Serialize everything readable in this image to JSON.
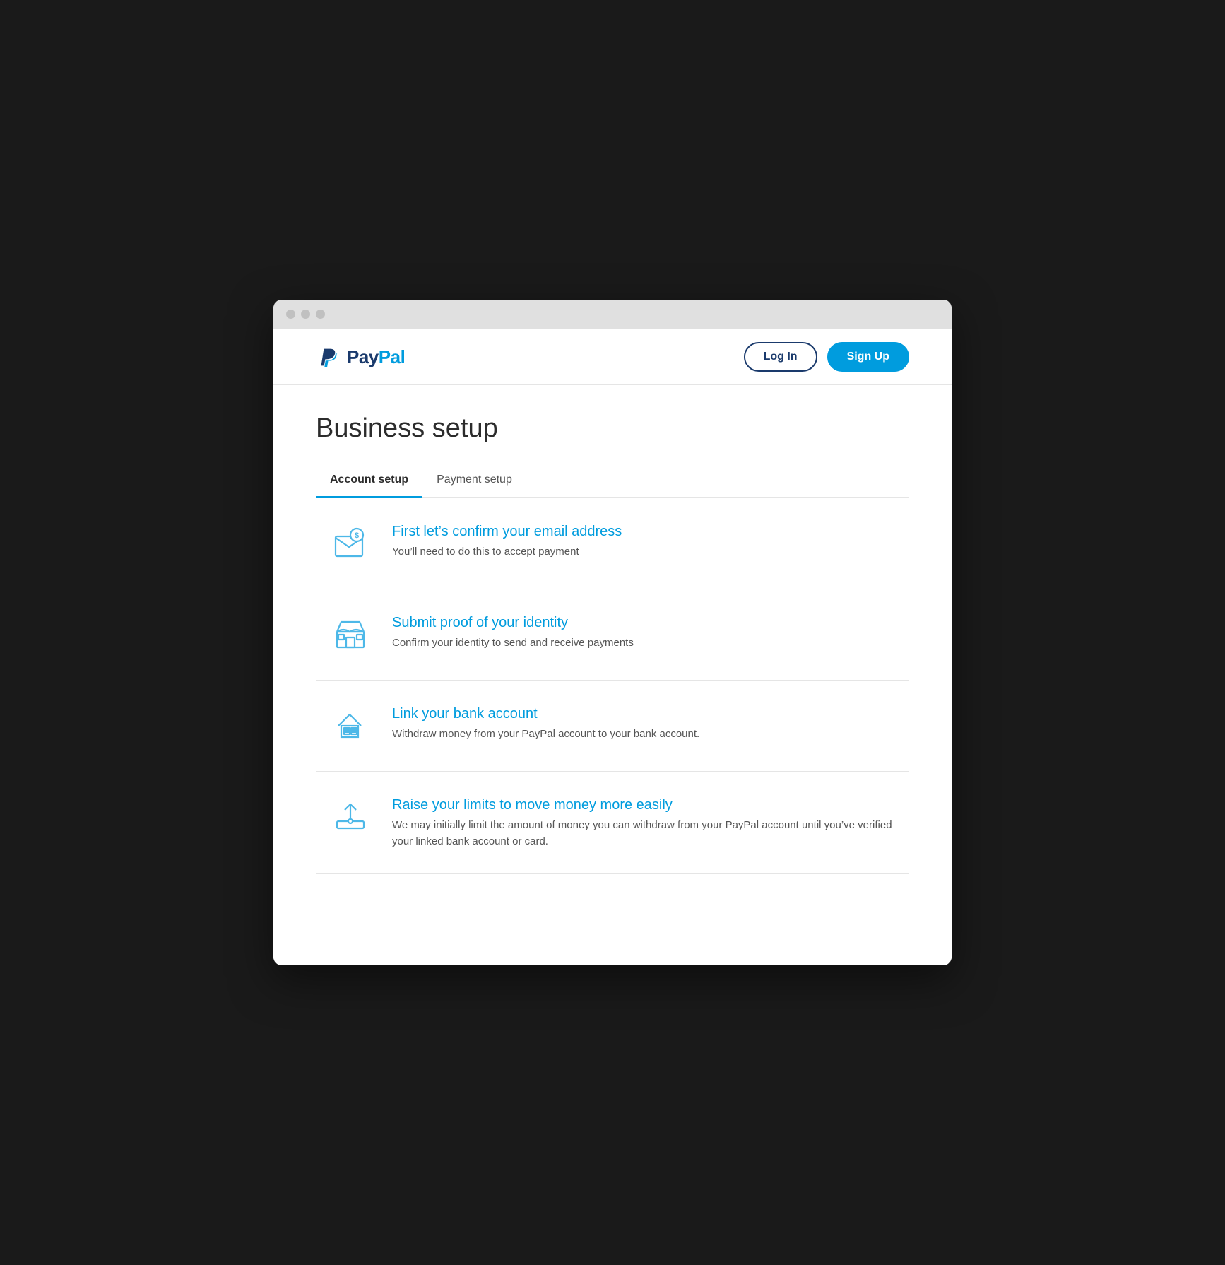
{
  "browser": {
    "dots": [
      "dot1",
      "dot2",
      "dot3"
    ]
  },
  "header": {
    "logo_pay": "Pay",
    "logo_pal": "Pal",
    "login_label": "Log In",
    "signup_label": "Sign Up"
  },
  "main": {
    "page_title": "Business setup",
    "tabs": [
      {
        "id": "account-setup",
        "label": "Account setup",
        "active": true
      },
      {
        "id": "payment-setup",
        "label": "Payment setup",
        "active": false
      }
    ],
    "setup_items": [
      {
        "id": "confirm-email",
        "title": "First let’s confirm your email address",
        "description": "You’ll need to do this to accept payment",
        "icon": "email"
      },
      {
        "id": "submit-identity",
        "title": "Submit proof of your identity",
        "description": "Confirm your identity to send and receive payments",
        "icon": "store"
      },
      {
        "id": "link-bank",
        "title": "Link your bank account",
        "description": "Withdraw money from your PayPal account to your bank account.",
        "icon": "bank"
      },
      {
        "id": "raise-limits",
        "title": "Raise your limits to move money more easily",
        "description": "We may initially limit the amount of money you can withdraw from your PayPal account until you’ve verified your linked bank account or card.",
        "icon": "upload"
      }
    ]
  },
  "colors": {
    "accent_blue": "#009cde",
    "dark_blue": "#1a3a6c",
    "icon_blue": "#4db8e8"
  }
}
